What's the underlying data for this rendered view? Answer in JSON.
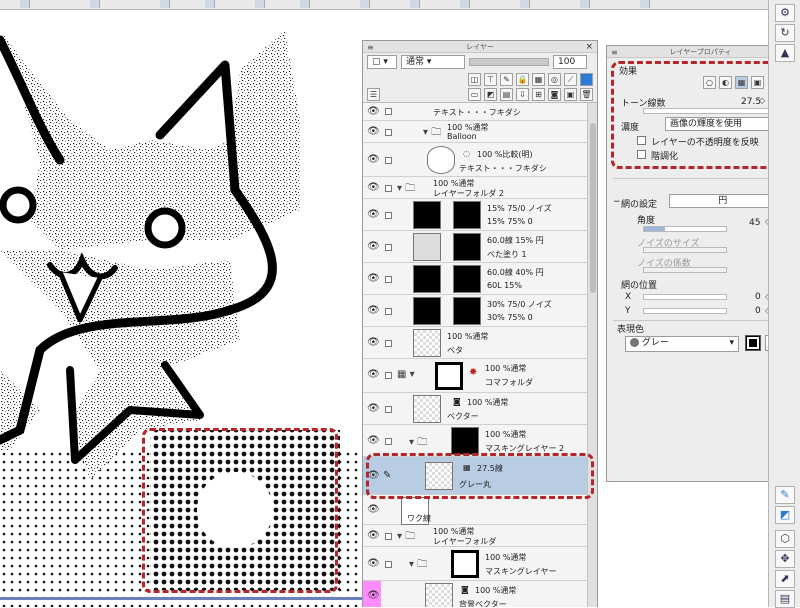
{
  "layer_panel": {
    "title": "レイヤー",
    "blend_mode": "通常",
    "opacity": "100",
    "layers": [
      {
        "name": "テキスト・・・フキダシ",
        "props": ""
      },
      {
        "name": "Balloon",
        "props": "100 %通常",
        "type": "folder"
      },
      {
        "name": "テキスト・・・フキダシ",
        "props": "100 %比較(明)"
      },
      {
        "name": "レイヤーフォルダ 2",
        "props": "100 %通常",
        "type": "folder"
      },
      {
        "name": "15% 75% 0",
        "props": "15% 75/0 ノイズ"
      },
      {
        "name": "べた塗り 1",
        "props": "60.0線 15% 円"
      },
      {
        "name": "60L 15%",
        "props": "60.0線 40% 円"
      },
      {
        "name": "30% 75% 0",
        "props": "30% 75/0 ノイズ"
      },
      {
        "name": "ベタ",
        "props": "100 %通常"
      },
      {
        "name": "コマフォルダ",
        "props": "100 %通常",
        "type": "folder"
      },
      {
        "name": "ベクター",
        "props": "100 %通常"
      },
      {
        "name": "マスキングレイヤー 2",
        "props": "100 %通常",
        "type": "folder"
      },
      {
        "name": "グレー丸",
        "props": "27.5線",
        "selected": true
      },
      {
        "name": "ワク線",
        "props": ""
      },
      {
        "name": "レイヤーフォルダ",
        "props": "100 %通常",
        "type": "folder"
      },
      {
        "name": "マスキングレイヤー",
        "props": "100 %通常",
        "type": "folder"
      },
      {
        "name": "背景ベクター",
        "props": "100 %通常"
      }
    ]
  },
  "prop_panel": {
    "title": "レイヤープロパティ",
    "effect_label": "効果",
    "tone_lines_label": "トーン線数",
    "tone_lines_value": "27.5",
    "density_label": "濃度",
    "density_value": "画像の輝度を使用",
    "reflect_opacity_label": "レイヤーの不透明度を反映",
    "posterize_label": "階調化",
    "mesh_setting_label": "網の設定",
    "mesh_setting_value": "円",
    "angle_label": "角度",
    "angle_value": "45",
    "noise_size_label": "ノイズのサイズ",
    "noise_factor_label": "ノイズの係数",
    "mesh_position_label": "網の位置",
    "x_label": "X",
    "x_value": "0",
    "y_label": "Y",
    "y_value": "0",
    "expression_color_label": "表現色",
    "expression_color_value": "グレー"
  },
  "colors": {
    "highlight_red": "#b3262b",
    "selected_row": "#b8cde4",
    "accent_blue": "#2d7ad6"
  }
}
